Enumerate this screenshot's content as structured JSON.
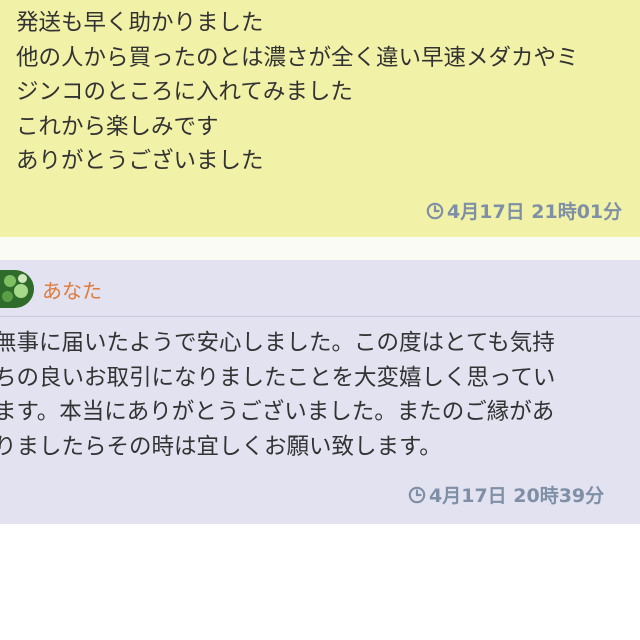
{
  "messages": [
    {
      "lines": [
        "発送も早く助かりました",
        "他の人から買ったのとは濃さが全く違い早速メダカやミ",
        "ジンコのところに入れてみました",
        "これから楽しみです",
        "ありがとうございました"
      ],
      "timestamp": "4月17日 21時01分"
    },
    {
      "sender": "あなた",
      "lines": [
        "無事に届いたようで安心しました。この度はとても気持",
        "ちの良いお取引になりましたことを大変嬉しく思ってい",
        "ます。本当にありがとうございました。またのご縁があ",
        "りましたらその時は宜しくお願い致します。"
      ],
      "timestamp": "4月17日 20時39分"
    }
  ],
  "colors": {
    "buyer_bubble": "#f1f1a8",
    "seller_bubble": "#e2e2f1",
    "sender_name": "#e07b3a",
    "timestamp": "#7f8fa6"
  },
  "icons": {
    "timestamp": "clock-icon",
    "avatar": "avatar"
  }
}
